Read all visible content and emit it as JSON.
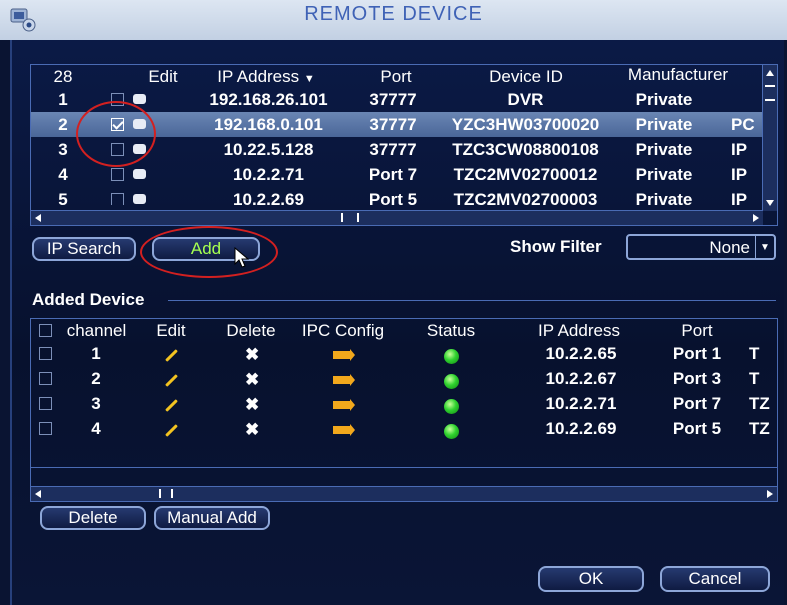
{
  "window": {
    "title": "REMOTE DEVICE"
  },
  "remote_table": {
    "headers": {
      "count": "28",
      "edit": "Edit",
      "ip": "IP Address",
      "port": "Port",
      "device_id": "Device ID",
      "manufacturer": "Manufacturer"
    },
    "rows": [
      {
        "no": "1",
        "ip": "192.168.26.101",
        "port": "37777",
        "device_id": "DVR",
        "manufacturer": "Private",
        "extra": ""
      },
      {
        "no": "2",
        "ip": "192.168.0.101",
        "port": "37777",
        "device_id": "YZC3HW03700020",
        "manufacturer": "Private",
        "extra": "PC",
        "checked": true
      },
      {
        "no": "3",
        "ip": "10.22.5.128",
        "port": "37777",
        "device_id": "TZC3CW08800108",
        "manufacturer": "Private",
        "extra": "IP"
      },
      {
        "no": "4",
        "ip": "10.2.2.71",
        "port": "Port 7",
        "device_id": "TZC2MV02700012",
        "manufacturer": "Private",
        "extra": "IP"
      },
      {
        "no": "5",
        "ip": "10.2.2.69",
        "port": "Port 5",
        "device_id": "TZC2MV02700003",
        "manufacturer": "Private",
        "extra": "IP"
      }
    ]
  },
  "controls": {
    "ip_search_label": "IP Search",
    "add_label": "Add",
    "show_filter_label": "Show Filter",
    "filter_value": "None"
  },
  "added_section": {
    "label": "Added Device"
  },
  "added_table": {
    "headers": {
      "channel": "channel",
      "edit": "Edit",
      "delete": "Delete",
      "ipc_config": "IPC Config",
      "status": "Status",
      "ip": "IP Address",
      "port": "Port"
    },
    "rows": [
      {
        "channel": "1",
        "ip": "10.2.2.65",
        "port": "Port 1",
        "extra": "T"
      },
      {
        "channel": "2",
        "ip": "10.2.2.67",
        "port": "Port 3",
        "extra": "T"
      },
      {
        "channel": "3",
        "ip": "10.2.2.71",
        "port": "Port 7",
        "extra": "TZ"
      },
      {
        "channel": "4",
        "ip": "10.2.2.69",
        "port": "Port 5",
        "extra": "TZ"
      }
    ]
  },
  "buttons": {
    "delete": "Delete",
    "manual_add": "Manual Add",
    "ok": "OK",
    "cancel": "Cancel"
  },
  "colors": {
    "accent": "#8da6d8",
    "highlight_ring": "#d32020",
    "status_online": "#2fd22f",
    "background": "#0a1432"
  }
}
